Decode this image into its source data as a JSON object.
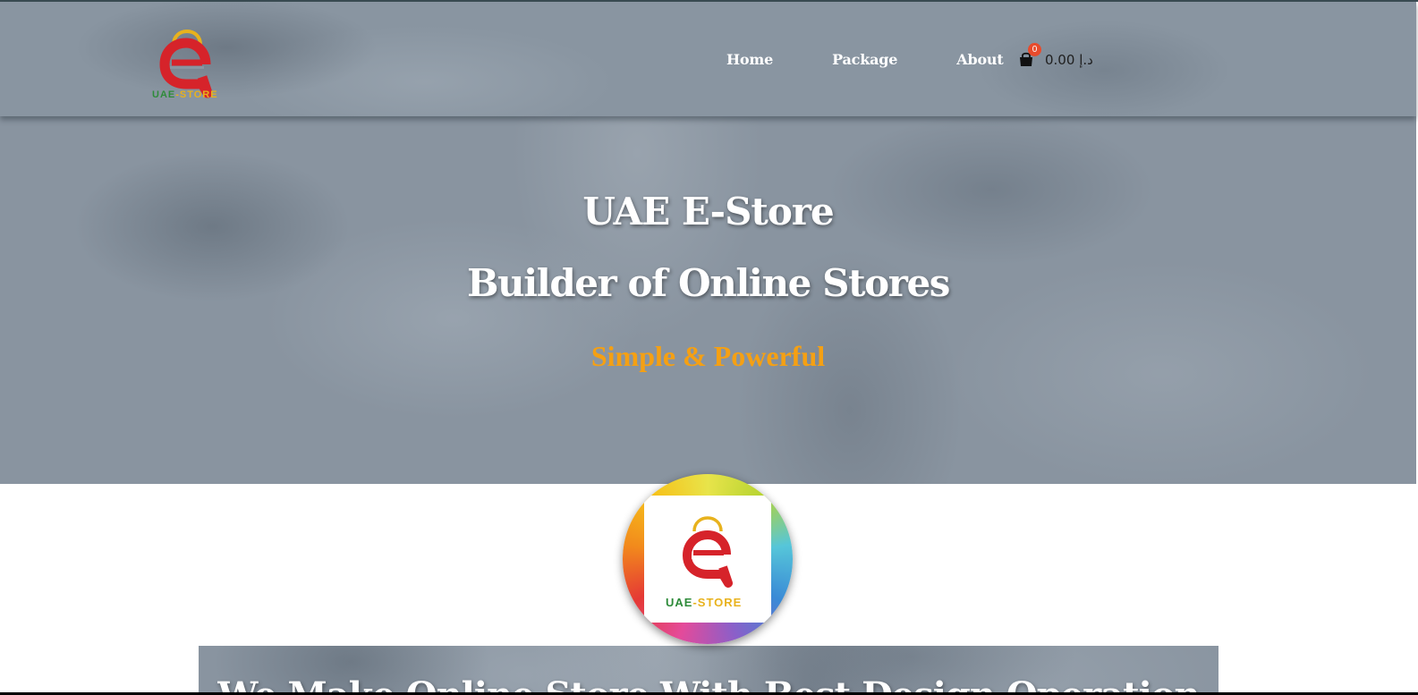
{
  "header": {
    "logo_text_uae": "UAE",
    "logo_text_store": "-STORE",
    "nav": [
      {
        "label": "Home"
      },
      {
        "label": "Package"
      },
      {
        "label": "About"
      }
    ],
    "cart": {
      "count": "0",
      "amount": "0.00",
      "currency": "د.إ"
    }
  },
  "hero": {
    "title_line1": "UAE E-Store",
    "title_line2": "Builder of Online Stores",
    "tagline": "Simple & Powerful"
  },
  "badge": {
    "text_uae": "UAE",
    "text_store": "-STORE"
  },
  "band": {
    "heading": "We Make Online Store With Best Design Operation"
  },
  "colors": {
    "logo_red": "#d6232a",
    "logo_gold": "#e8b21d",
    "logo_green": "#2e8b3a",
    "tagline_orange": "#f5a013",
    "cart_badge": "#e84b2c"
  }
}
